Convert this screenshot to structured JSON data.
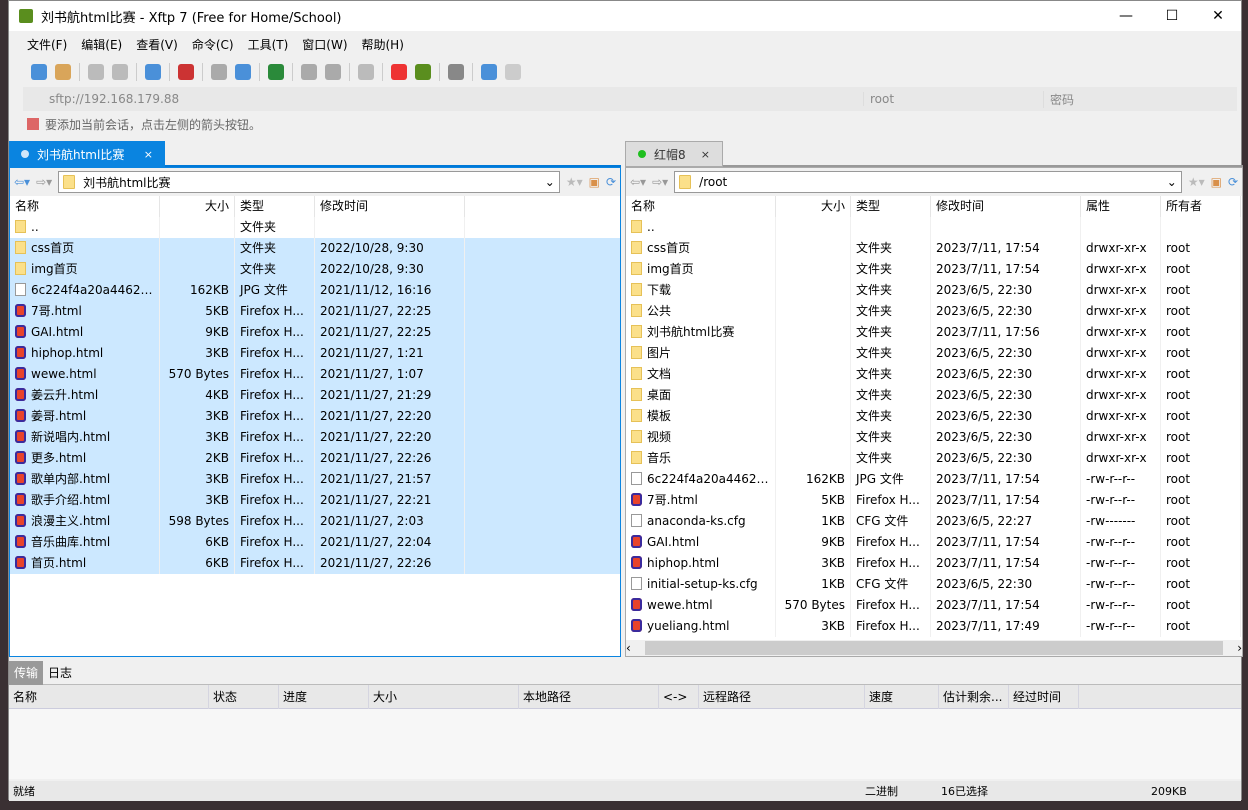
{
  "title": "刘书航html比赛 - Xftp 7 (Free for Home/School)",
  "menu": [
    "文件(F)",
    "编辑(E)",
    "查看(V)",
    "命令(C)",
    "工具(T)",
    "窗口(W)",
    "帮助(H)"
  ],
  "toolbar_icons": [
    "new-session-icon",
    "open-folder-icon",
    "disconnect-icon",
    "reconnect-icon",
    "new-tab-icon",
    "terminal-icon",
    "upload-icon",
    "download-icon",
    "sync-icon",
    "copy-icon",
    "paste-icon",
    "status-icon",
    "xshell-icon",
    "xftp-icon",
    "settings-icon",
    "help-icon",
    "chat-icon"
  ],
  "address": {
    "url": "sftp://192.168.179.88",
    "user_placeholder": "root",
    "password_placeholder": "密码"
  },
  "hint": "要添加当前会话，点击左侧的箭头按钮。",
  "left": {
    "tab": "刘书航html比赛",
    "path": "刘书航html比赛",
    "headers": [
      "名称",
      "大小",
      "类型",
      "修改时间"
    ],
    "rows": [
      [
        "..",
        "",
        "文件夹",
        "",
        "folder",
        false
      ],
      [
        "css首页",
        "",
        "文件夹",
        "2022/10/28, 9:30",
        "folder",
        true
      ],
      [
        "img首页",
        "",
        "文件夹",
        "2022/10/28, 9:30",
        "folder",
        true
      ],
      [
        "6c224f4a20a446230...",
        "162KB",
        "JPG 文件",
        "2021/11/12, 16:16",
        "jpg",
        true
      ],
      [
        "7哥.html",
        "5KB",
        "Firefox H...",
        "2021/11/27, 22:25",
        "html",
        true
      ],
      [
        "GAI.html",
        "9KB",
        "Firefox H...",
        "2021/11/27, 22:25",
        "html",
        true
      ],
      [
        "hiphop.html",
        "3KB",
        "Firefox H...",
        "2021/11/27, 1:21",
        "html",
        true
      ],
      [
        "wewe.html",
        "570 Bytes",
        "Firefox H...",
        "2021/11/27, 1:07",
        "html",
        true
      ],
      [
        "姜云升.html",
        "4KB",
        "Firefox H...",
        "2021/11/27, 21:29",
        "html",
        true
      ],
      [
        "姜哥.html",
        "3KB",
        "Firefox H...",
        "2021/11/27, 22:20",
        "html",
        true
      ],
      [
        "新说唱内.html",
        "3KB",
        "Firefox H...",
        "2021/11/27, 22:20",
        "html",
        true
      ],
      [
        "更多.html",
        "2KB",
        "Firefox H...",
        "2021/11/27, 22:26",
        "html",
        true
      ],
      [
        "歌单内部.html",
        "3KB",
        "Firefox H...",
        "2021/11/27, 21:57",
        "html",
        true
      ],
      [
        "歌手介绍.html",
        "3KB",
        "Firefox H...",
        "2021/11/27, 22:21",
        "html",
        true
      ],
      [
        "浪漫主义.html",
        "598 Bytes",
        "Firefox H...",
        "2021/11/27, 2:03",
        "html",
        true
      ],
      [
        "音乐曲库.html",
        "6KB",
        "Firefox H...",
        "2021/11/27, 22:04",
        "html",
        true
      ],
      [
        "首页.html",
        "6KB",
        "Firefox H...",
        "2021/11/27, 22:26",
        "html",
        true
      ]
    ]
  },
  "right": {
    "tab": "红帽8",
    "path": "/root",
    "headers": [
      "名称",
      "大小",
      "类型",
      "修改时间",
      "属性",
      "所有者"
    ],
    "rows": [
      [
        "..",
        "",
        "",
        "",
        "",
        "",
        "folder"
      ],
      [
        "css首页",
        "",
        "文件夹",
        "2023/7/11, 17:54",
        "drwxr-xr-x",
        "root",
        "folder"
      ],
      [
        "img首页",
        "",
        "文件夹",
        "2023/7/11, 17:54",
        "drwxr-xr-x",
        "root",
        "folder"
      ],
      [
        "下载",
        "",
        "文件夹",
        "2023/6/5, 22:30",
        "drwxr-xr-x",
        "root",
        "folder"
      ],
      [
        "公共",
        "",
        "文件夹",
        "2023/6/5, 22:30",
        "drwxr-xr-x",
        "root",
        "folder"
      ],
      [
        "刘书航html比赛",
        "",
        "文件夹",
        "2023/7/11, 17:56",
        "drwxr-xr-x",
        "root",
        "folder"
      ],
      [
        "图片",
        "",
        "文件夹",
        "2023/6/5, 22:30",
        "drwxr-xr-x",
        "root",
        "folder"
      ],
      [
        "文档",
        "",
        "文件夹",
        "2023/6/5, 22:30",
        "drwxr-xr-x",
        "root",
        "folder"
      ],
      [
        "桌面",
        "",
        "文件夹",
        "2023/6/5, 22:30",
        "drwxr-xr-x",
        "root",
        "folder"
      ],
      [
        "模板",
        "",
        "文件夹",
        "2023/6/5, 22:30",
        "drwxr-xr-x",
        "root",
        "folder"
      ],
      [
        "视频",
        "",
        "文件夹",
        "2023/6/5, 22:30",
        "drwxr-xr-x",
        "root",
        "folder"
      ],
      [
        "音乐",
        "",
        "文件夹",
        "2023/6/5, 22:30",
        "drwxr-xr-x",
        "root",
        "folder"
      ],
      [
        "6c224f4a20a446230...",
        "162KB",
        "JPG 文件",
        "2023/7/11, 17:54",
        "-rw-r--r--",
        "root",
        "jpg"
      ],
      [
        "7哥.html",
        "5KB",
        "Firefox H...",
        "2023/7/11, 17:54",
        "-rw-r--r--",
        "root",
        "html"
      ],
      [
        "anaconda-ks.cfg",
        "1KB",
        "CFG 文件",
        "2023/6/5, 22:27",
        "-rw-------",
        "root",
        "cfg"
      ],
      [
        "GAI.html",
        "9KB",
        "Firefox H...",
        "2023/7/11, 17:54",
        "-rw-r--r--",
        "root",
        "html"
      ],
      [
        "hiphop.html",
        "3KB",
        "Firefox H...",
        "2023/7/11, 17:54",
        "-rw-r--r--",
        "root",
        "html"
      ],
      [
        "initial-setup-ks.cfg",
        "1KB",
        "CFG 文件",
        "2023/6/5, 22:30",
        "-rw-r--r--",
        "root",
        "cfg"
      ],
      [
        "wewe.html",
        "570 Bytes",
        "Firefox H...",
        "2023/7/11, 17:54",
        "-rw-r--r--",
        "root",
        "html"
      ],
      [
        "yueliang.html",
        "3KB",
        "Firefox H...",
        "2023/7/11, 17:49",
        "-rw-r--r--",
        "root",
        "html"
      ]
    ]
  },
  "bottom": {
    "tabs": [
      "传输",
      "日志"
    ],
    "headers": [
      "名称",
      "状态",
      "进度",
      "大小",
      "本地路径",
      "<->",
      "远程路径",
      "速度",
      "估计剩余...",
      "经过时间"
    ]
  },
  "status": {
    "text": "就绪",
    "mode": "二进制",
    "selected": "16已选择",
    "size": "209KB"
  },
  "colors": {
    "accent": "#0a84e0",
    "selection": "#cce8ff"
  }
}
